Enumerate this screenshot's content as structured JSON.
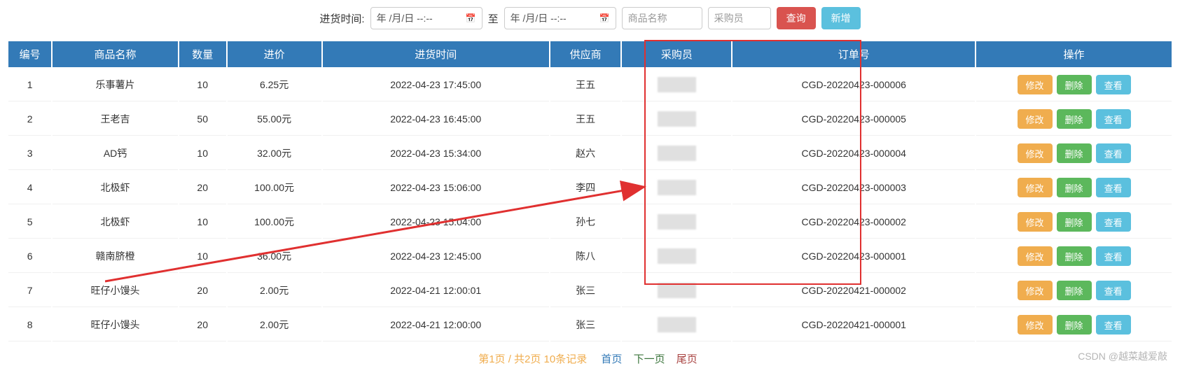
{
  "search": {
    "label": "进货时间:",
    "date1_placeholder": "年 /月/日 --:--",
    "to_label": "至",
    "date2_placeholder": "年 /月/日 --:--",
    "product_placeholder": "商品名称",
    "buyer_placeholder": "采购员",
    "query_btn": "查询",
    "add_btn": "新增"
  },
  "table": {
    "headers": {
      "id": "编号",
      "name": "商品名称",
      "qty": "数量",
      "price": "进价",
      "time": "进货时间",
      "supplier": "供应商",
      "buyer": "采购员",
      "order": "订单号",
      "action": "操作"
    },
    "action_labels": {
      "edit": "修改",
      "delete": "删除",
      "view": "查看"
    },
    "rows": [
      {
        "id": "1",
        "name": "乐事薯片",
        "qty": "10",
        "price": "6.25元",
        "time": "2022-04-23 17:45:00",
        "supplier": "王五",
        "order": "CGD-20220423-000006"
      },
      {
        "id": "2",
        "name": "王老吉",
        "qty": "50",
        "price": "55.00元",
        "time": "2022-04-23 16:45:00",
        "supplier": "王五",
        "order": "CGD-20220423-000005"
      },
      {
        "id": "3",
        "name": "AD钙",
        "qty": "10",
        "price": "32.00元",
        "time": "2022-04-23 15:34:00",
        "supplier": "赵六",
        "order": "CGD-20220423-000004"
      },
      {
        "id": "4",
        "name": "北极虾",
        "qty": "20",
        "price": "100.00元",
        "time": "2022-04-23 15:06:00",
        "supplier": "李四",
        "order": "CGD-20220423-000003"
      },
      {
        "id": "5",
        "name": "北极虾",
        "qty": "10",
        "price": "100.00元",
        "time": "2022-04-23 15:04:00",
        "supplier": "孙七",
        "order": "CGD-20220423-000002"
      },
      {
        "id": "6",
        "name": "赣南脐橙",
        "qty": "10",
        "price": "36.00元",
        "time": "2022-04-23 12:45:00",
        "supplier": "陈八",
        "order": "CGD-20220423-000001"
      },
      {
        "id": "7",
        "name": "旺仔小馒头",
        "qty": "20",
        "price": "2.00元",
        "time": "2022-04-21 12:00:01",
        "supplier": "张三",
        "order": "CGD-20220421-000002"
      },
      {
        "id": "8",
        "name": "旺仔小馒头",
        "qty": "20",
        "price": "2.00元",
        "time": "2022-04-21 12:00:00",
        "supplier": "张三",
        "order": "CGD-20220421-000001"
      }
    ]
  },
  "pager": {
    "info": "第1页 / 共2页 10条记录",
    "first": "首页",
    "next": "下一页",
    "last": "尾页"
  },
  "watermark": "CSDN @越菜越爱敲"
}
